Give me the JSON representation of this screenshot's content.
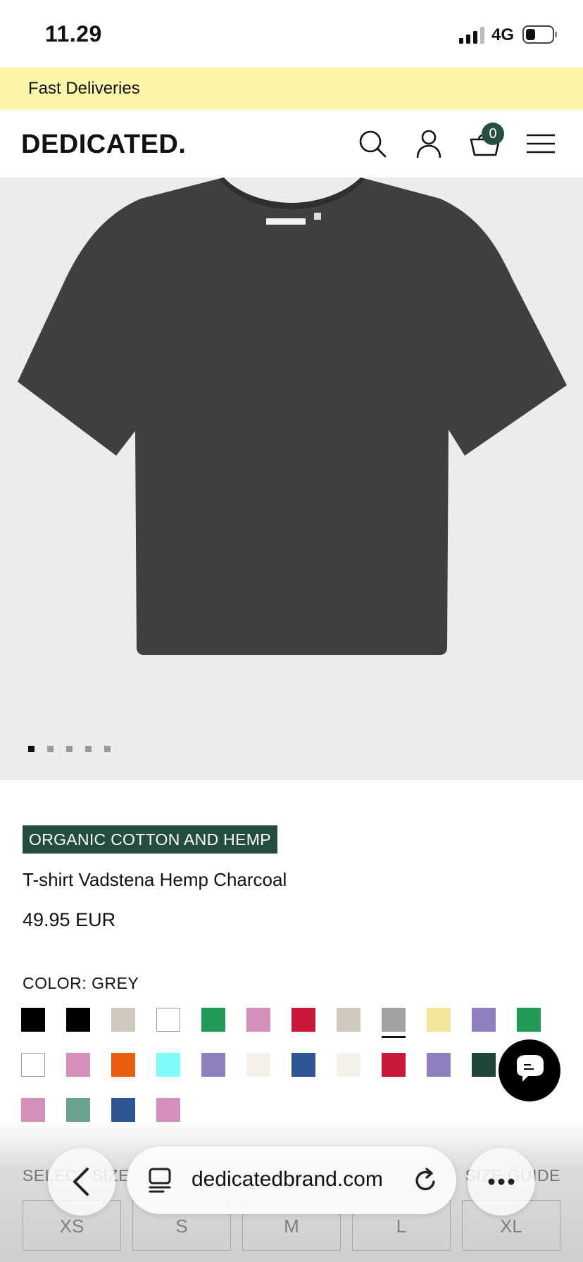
{
  "status_bar": {
    "time": "11.29",
    "network": "4G",
    "icons": [
      "signal-icon",
      "battery-icon"
    ]
  },
  "promo": {
    "text": "Fast Deliveries",
    "background": "#fcf6a9"
  },
  "header": {
    "logo": "DEDICATED.",
    "icons": [
      "search-icon",
      "account-icon",
      "cart-icon",
      "menu-icon"
    ],
    "cart_count": "0",
    "badge_color": "#264e42"
  },
  "gallery": {
    "image": "charcoal t-shirt",
    "dots": [
      true,
      false,
      false,
      false,
      false
    ]
  },
  "product": {
    "badge": "ORGANIC COTTON AND HEMP",
    "badge_color": "#234d41",
    "title": "T-shirt Vadstena Hemp Charcoal",
    "price": "49.95 EUR"
  },
  "color": {
    "label": "COLOR: GREY",
    "swatches": [
      "#000000",
      "#000000",
      "#cfc9bd",
      "#ffffff",
      "#239a53",
      "#d48fb8",
      "#c8193a",
      "#cfc9bd",
      "#a1a1a1",
      "#f1e699",
      "#8f7fbe",
      "#239a53",
      "#ffffff",
      "#d48fb8",
      "#e85d0f",
      "#7ef9fc",
      "#8f7fbe",
      "#f3f1e8",
      "#2e5592",
      "#f3f1e8",
      "#c8193a",
      "#8f7fbe",
      "#1f4539",
      "#8f7fbe",
      "#d48fb8",
      "#6aa38d",
      "#2e5592",
      "#d48fb8"
    ],
    "selected_index": 8
  },
  "size": {
    "label": "SELECT SIZE",
    "guide": "SIZE GUIDE",
    "options": [
      "XS",
      "S",
      "M",
      "L",
      "XL"
    ]
  },
  "browser": {
    "url": "dedicatedbrand.com",
    "icons": [
      "back-icon",
      "tabs-icon",
      "reload-icon",
      "more-icon"
    ]
  },
  "chat": {
    "icon": "chat-icon"
  }
}
